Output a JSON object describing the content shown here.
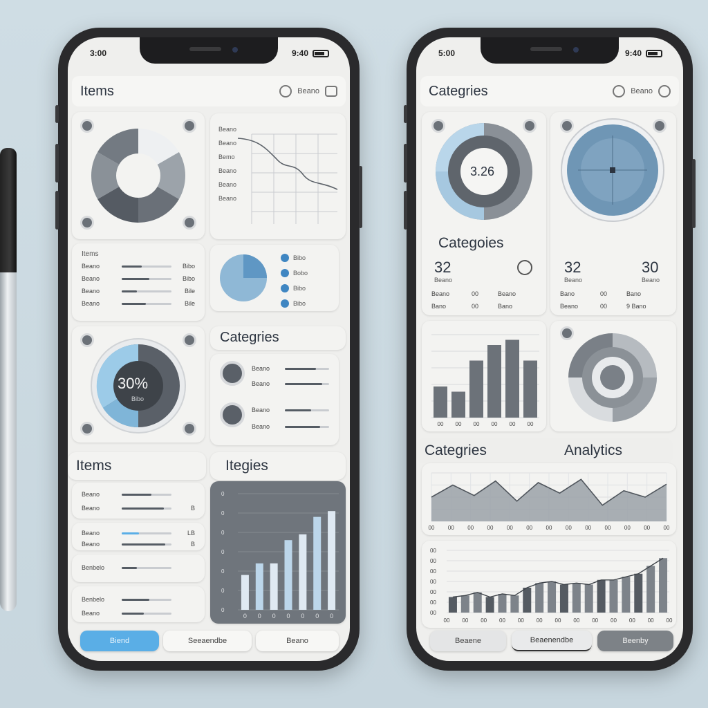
{
  "left": {
    "status_time": "3:00",
    "status_right": "9:40",
    "header_title": "Items",
    "header_tool": "Beano",
    "line_card_labels": [
      "Beano",
      "Beano",
      "Bemo",
      "Beano",
      "Beano",
      "Beano"
    ],
    "list_card": {
      "title": "Items",
      "rows": [
        {
          "label": "Beano",
          "value": "Bibo"
        },
        {
          "label": "Beano",
          "value": "Bibo"
        },
        {
          "label": "Beano",
          "value": "Bile"
        },
        {
          "label": "Beano",
          "value": "Bile"
        }
      ]
    },
    "legend": [
      "Bibo",
      "Bobo",
      "Bibo",
      "Bibo"
    ],
    "ring_value": "30%",
    "ring_caption": "Bibo",
    "categories_title": "Categries",
    "cat_rows": [
      "Beano",
      "Beano",
      "Beano",
      "Beano"
    ],
    "items_title": "Items",
    "itegies_title": "Itegies",
    "item_rows": [
      {
        "label": "Beano",
        "value": ""
      },
      {
        "label": "Beano",
        "value": "B"
      },
      {
        "label": "Beano",
        "value": "LB"
      },
      {
        "label": "Beano",
        "value": "B"
      },
      {
        "label": "Benbelo",
        "value": ""
      },
      {
        "label": "Benbelo",
        "value": ""
      },
      {
        "label": "Beano",
        "value": ""
      }
    ],
    "bars_ticks": [
      "0",
      "0",
      "0",
      "0",
      "0",
      "0",
      "0"
    ],
    "bars_y_ticks": [
      "0",
      "0",
      "0",
      "0",
      "0",
      "0",
      "0"
    ],
    "buttons": [
      "Biend",
      "Seeaendbe",
      "Beano"
    ],
    "bar_chart_data": {
      "type": "bar",
      "values": [
        3,
        4,
        4,
        6,
        6.5,
        8,
        8.5
      ],
      "ylim": [
        0,
        10
      ]
    }
  },
  "right": {
    "status_time": "5:00",
    "status_right": "9:40",
    "header_title": "Categries",
    "header_tool": "Beano",
    "gauge_value": "3.26",
    "categories_title": "Categoies",
    "stats": [
      {
        "num": "32",
        "label": "Beano"
      },
      {
        "num": "32",
        "label": "Beano"
      },
      {
        "num": "30",
        "label": "Beano"
      }
    ],
    "stat_rows": [
      {
        "a": "Beano",
        "b": "00",
        "c": "Beano"
      },
      {
        "a": "Bano",
        "b": "00",
        "c": "Bano"
      }
    ],
    "stat_rows_2": [
      {
        "a": "Bano",
        "b": "00",
        "c": "Bano"
      },
      {
        "a": "Beano",
        "b": "00",
        "c": "9 Bano"
      }
    ],
    "bars_ticks": [
      "00",
      "00",
      "00",
      "00",
      "00",
      "00"
    ],
    "categories_title2": "Categries",
    "analytics_title": "Analytics",
    "wave_ticks": [
      "00",
      "00",
      "00",
      "00",
      "00",
      "00",
      "00",
      "00",
      "00",
      "00",
      "00",
      "00",
      "00"
    ],
    "bottom_y_ticks": [
      "00",
      "00",
      "00",
      "00",
      "00",
      "00",
      "00"
    ],
    "bottom_x_ticks": [
      "00",
      "00",
      "00",
      "00",
      "00",
      "00",
      "00",
      "00",
      "00",
      "00",
      "00",
      "00",
      "00"
    ],
    "buttons": [
      "Beaene",
      "Beaenendbe",
      "Beenby"
    ],
    "top_bar_data": {
      "type": "bar",
      "values": [
        3,
        2.5,
        5.5,
        7,
        7.5,
        5.5
      ],
      "ylim": [
        0,
        8
      ]
    },
    "wave_data": {
      "type": "area",
      "values": [
        3,
        4.5,
        3.2,
        5,
        2.5,
        4.8,
        3.5,
        5.2,
        2,
        3.8,
        3,
        4.6
      ],
      "ylim": [
        0,
        6
      ]
    },
    "bottom_bar_data": {
      "type": "bar",
      "values": [
        2,
        2.2,
        2.6,
        2,
        2.4,
        2.2,
        3.2,
        3.8,
        4,
        3.6,
        3.8,
        3.6,
        4.2,
        4.2,
        4.6,
        5,
        6,
        7
      ],
      "ylim": [
        0,
        8
      ]
    }
  },
  "colors": {
    "accent_blue": "#5aaee6",
    "dark_gray": "#5d636a",
    "light_gray": "#c9ccd0"
  }
}
